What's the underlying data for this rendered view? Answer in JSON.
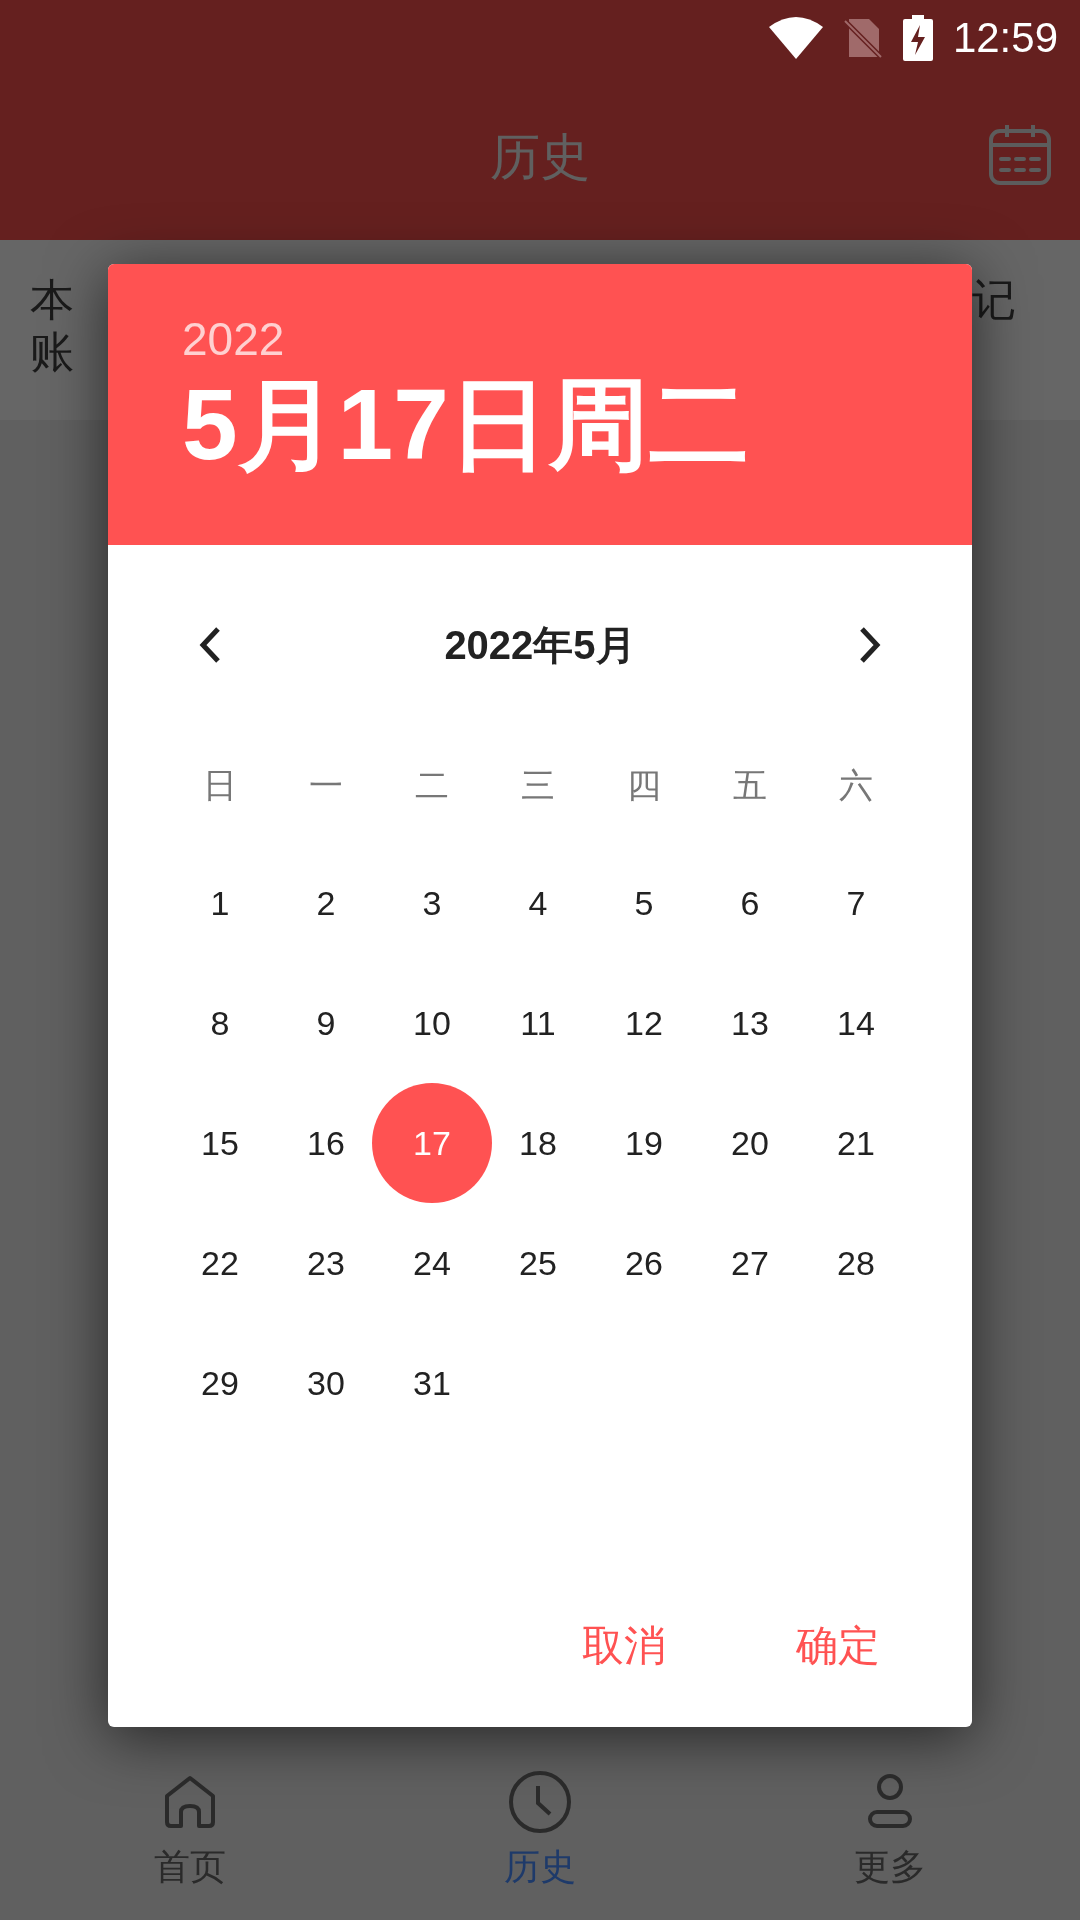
{
  "status_bar": {
    "time": "12:59"
  },
  "app_bar": {
    "title": "历史"
  },
  "content": {
    "line_1_start": "本",
    "line_1_end": "记",
    "line_2_start": "账"
  },
  "dialog": {
    "year": "2022",
    "date_heading": "5月17日周二",
    "month_label": "2022年5月",
    "weekdays": [
      "日",
      "一",
      "二",
      "三",
      "四",
      "五",
      "六"
    ],
    "days": [
      {
        "label": "1",
        "selected": false
      },
      {
        "label": "2",
        "selected": false
      },
      {
        "label": "3",
        "selected": false
      },
      {
        "label": "4",
        "selected": false
      },
      {
        "label": "5",
        "selected": false
      },
      {
        "label": "6",
        "selected": false
      },
      {
        "label": "7",
        "selected": false
      },
      {
        "label": "8",
        "selected": false
      },
      {
        "label": "9",
        "selected": false
      },
      {
        "label": "10",
        "selected": false
      },
      {
        "label": "11",
        "selected": false
      },
      {
        "label": "12",
        "selected": false
      },
      {
        "label": "13",
        "selected": false
      },
      {
        "label": "14",
        "selected": false
      },
      {
        "label": "15",
        "selected": false
      },
      {
        "label": "16",
        "selected": false
      },
      {
        "label": "17",
        "selected": true
      },
      {
        "label": "18",
        "selected": false
      },
      {
        "label": "19",
        "selected": false
      },
      {
        "label": "20",
        "selected": false
      },
      {
        "label": "21",
        "selected": false
      },
      {
        "label": "22",
        "selected": false
      },
      {
        "label": "23",
        "selected": false
      },
      {
        "label": "24",
        "selected": false
      },
      {
        "label": "25",
        "selected": false
      },
      {
        "label": "26",
        "selected": false
      },
      {
        "label": "27",
        "selected": false
      },
      {
        "label": "28",
        "selected": false
      },
      {
        "label": "29",
        "selected": false
      },
      {
        "label": "30",
        "selected": false
      },
      {
        "label": "31",
        "selected": false
      }
    ],
    "buttons": [
      "取消",
      "确定"
    ]
  },
  "bottom_nav": [
    {
      "kind": "home",
      "label": "首页",
      "selected": false
    },
    {
      "kind": "history",
      "label": "历史",
      "selected": true
    },
    {
      "kind": "more",
      "label": "更多",
      "selected": false
    }
  ]
}
